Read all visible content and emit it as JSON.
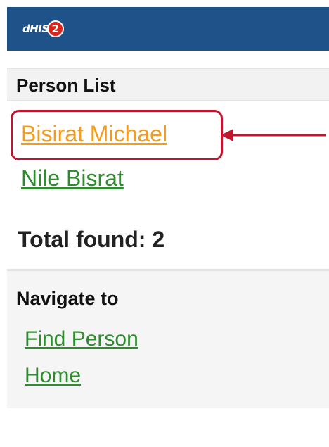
{
  "header": {
    "logo_text": "dHIS",
    "logo_badge": "2",
    "background": "#1f5288"
  },
  "person_list": {
    "title": "Person List",
    "persons": [
      {
        "name": "Bisirat Michael",
        "color": "#f29b1d",
        "highlighted": true
      },
      {
        "name": "Nile Bisrat",
        "color": "#2e8b2e",
        "highlighted": false
      }
    ],
    "total_found": "Total found: 2"
  },
  "navigation": {
    "title": "Navigate to",
    "links": [
      "Find Person",
      "Home"
    ]
  },
  "annotation": {
    "color": "#c0152e",
    "icon": "arrow-left-icon"
  }
}
